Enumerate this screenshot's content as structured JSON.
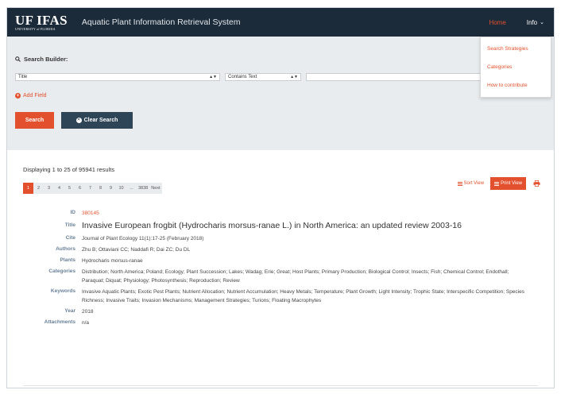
{
  "header": {
    "logo_main": "UF IFAS",
    "logo_sub": "UNIVERSITY of FLORIDA",
    "title": "Aquatic Plant Information Retrieval System",
    "nav_home": "Home",
    "nav_info": "Info"
  },
  "info_menu": {
    "items": [
      {
        "label": "Search Strategies"
      },
      {
        "label": "Categories"
      },
      {
        "label": "How to contribute"
      }
    ]
  },
  "builder": {
    "title": "Search Builder:",
    "field_select": "Title",
    "operator_select": "Contains Text",
    "value": "",
    "add_field_label": "Add Field",
    "search_label": "Search",
    "clear_label": "Clear Search"
  },
  "results": {
    "summary": "Displaying 1 to 25 of 95941 results",
    "sort_view_label": "Sort View",
    "print_view_label": "Print View",
    "pages": [
      "1",
      "2",
      "3",
      "4",
      "5",
      "6",
      "7",
      "8",
      "9",
      "10",
      "...",
      "3838",
      "Next"
    ],
    "active_page": "1"
  },
  "record": {
    "labels": {
      "id": "ID",
      "title": "Title",
      "cite": "Cite",
      "authors": "Authors",
      "plants": "Plants",
      "categories": "Categories",
      "keywords": "Keywords",
      "year": "Year",
      "attachments": "Attachments"
    },
    "id": "380145",
    "title": "Invasive European frogbit (Hydrocharis morsus-ranae L.) in North America: an updated review 2003-16",
    "cite": "Journal of Plant Ecology 11(1):17-25 (February 2018)",
    "authors": "Zhu B; Ottaviani CC; Naddafi R; Dai ZC; Du DL",
    "plants": "Hydrocharis morsus-ranae",
    "categories": "Distribution; North America; Poland; Ecology; Plant Succession; Lakes; Wadag; Erie; Great; Host Plants; Primary Production; Biological Control; Insects; Fish; Chemical Control; Endothall; Paraquat; Diquat; Physiology; Photosynthesis; Reproduction; Review",
    "keywords": "Invasive Aquatic Plants; Exotic Pest Plants; Nutrient Allocation; Nutrient Accumulation; Heavy Metals; Temperature; Plant Growth; Light Intensity; Trophic State; Interspecific Competition; Species Richness; Invasive Traits; Invasion Mechanisms; Management Strategies; Turions; Floating Macrophytes",
    "year": "2018",
    "attachments": "n/a"
  },
  "colors": {
    "accent": "#e2502d",
    "navbar": "#1c2b39",
    "builder_bg": "#e9ecef",
    "clear_button": "#2e4457",
    "label_blue": "#6a8199"
  },
  "icons": {
    "builder": "search-icon",
    "add": "plus-circle-icon",
    "clear": "x-circle-icon",
    "sort": "list-icon",
    "print_view": "list-icon",
    "print": "printer-icon",
    "info_menu": "chevron-down-icon"
  }
}
